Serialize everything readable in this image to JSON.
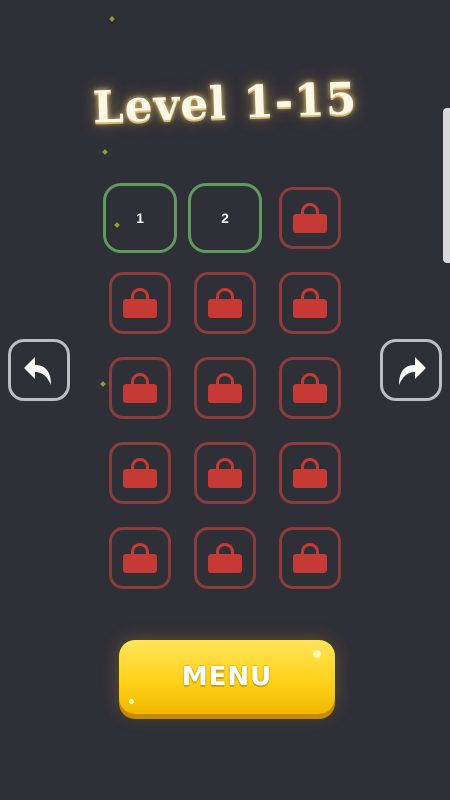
{
  "title": "Level 1-15",
  "levels": [
    {
      "label": "1",
      "state": "unlocked"
    },
    {
      "label": "2",
      "state": "unlocked"
    },
    {
      "label": "",
      "state": "locked"
    },
    {
      "label": "",
      "state": "locked"
    },
    {
      "label": "",
      "state": "locked"
    },
    {
      "label": "",
      "state": "locked"
    },
    {
      "label": "",
      "state": "locked"
    },
    {
      "label": "",
      "state": "locked"
    },
    {
      "label": "",
      "state": "locked"
    },
    {
      "label": "",
      "state": "locked"
    },
    {
      "label": "",
      "state": "locked"
    },
    {
      "label": "",
      "state": "locked"
    },
    {
      "label": "",
      "state": "locked"
    },
    {
      "label": "",
      "state": "locked"
    },
    {
      "label": "",
      "state": "locked"
    }
  ],
  "nav": {
    "prev_icon": "curved-arrow-left-icon",
    "next_icon": "curved-arrow-right-icon"
  },
  "menu_button": {
    "label": "MENU"
  },
  "colors": {
    "background": "#2f2f37",
    "unlocked_border": "#5f9a5f",
    "locked_border": "#8a3d3d",
    "lock_icon": "#c63a35",
    "menu_button": "#ffd21c"
  }
}
